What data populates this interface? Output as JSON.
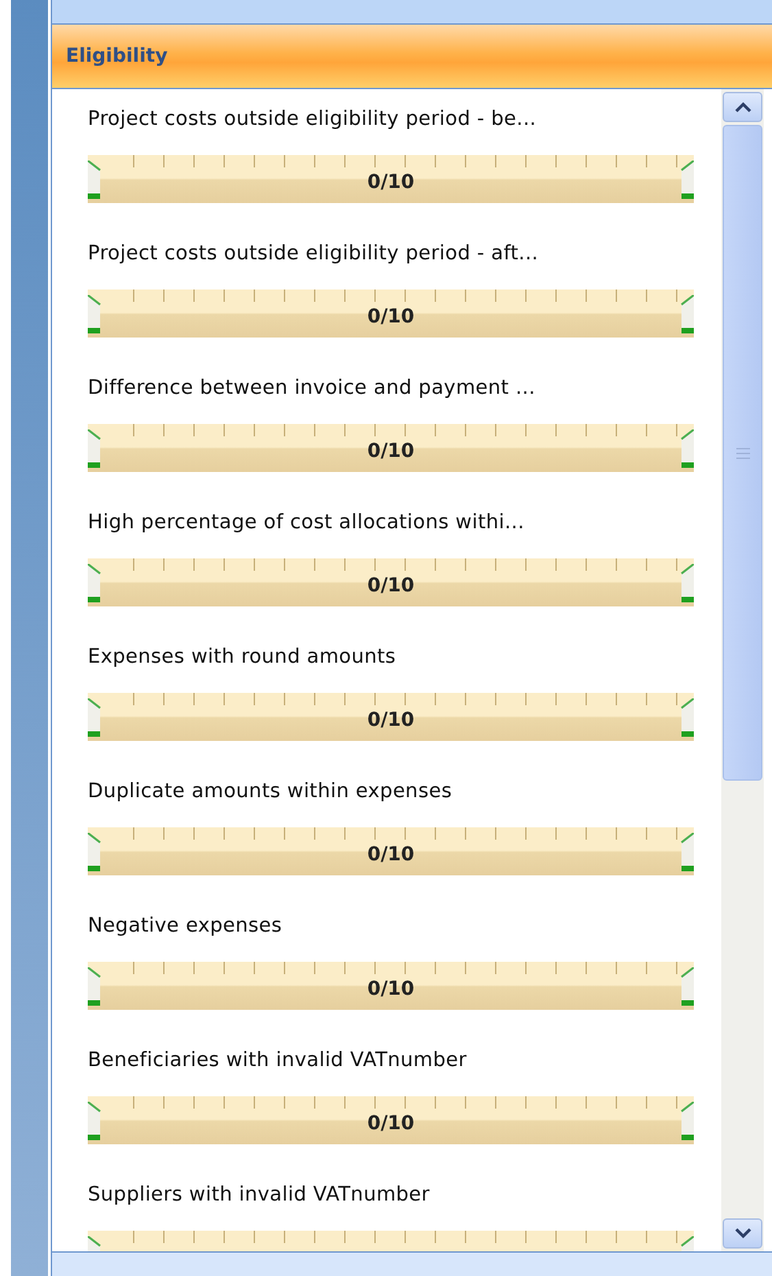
{
  "panel": {
    "title": "Eligibility"
  },
  "items": [
    {
      "label": "Project costs outside eligibility period - be...",
      "reading": "0/10",
      "thumbs": [
        {
          "level": 0
        },
        {
          "level": 1
        }
      ]
    },
    {
      "label": "Project costs outside eligibility period - aft...",
      "reading": "0/10",
      "thumbs": [
        {
          "level": 0
        },
        {
          "level": 1
        }
      ]
    },
    {
      "label": "Difference between invoice and payment ...",
      "reading": "0/10",
      "thumbs": [
        {
          "level": 0
        },
        {
          "level": 1
        }
      ]
    },
    {
      "label": "High percentage of cost allocations withi...",
      "reading": "0/10",
      "thumbs": [
        {
          "level": 0
        },
        {
          "level": 1
        }
      ]
    },
    {
      "label": "Expenses with round amounts",
      "reading": "0/10",
      "thumbs": [
        {
          "level": 0
        },
        {
          "level": 1
        }
      ]
    },
    {
      "label": "Duplicate amounts within expenses",
      "reading": "0/10",
      "thumbs": [
        {
          "level": 0
        },
        {
          "level": 1
        }
      ]
    },
    {
      "label": "Negative expenses",
      "reading": "0/10",
      "thumbs": [
        {
          "level": 0
        },
        {
          "level": 1
        }
      ]
    },
    {
      "label": "Beneficiaries with invalid VATnumber",
      "reading": "0/10",
      "thumbs": [
        {
          "level": 0
        },
        {
          "level": 1
        }
      ]
    },
    {
      "label": "Suppliers with invalid VATnumber",
      "thumbs": [
        {
          "level": 0
        },
        {
          "level": 1
        }
      ]
    }
  ]
}
